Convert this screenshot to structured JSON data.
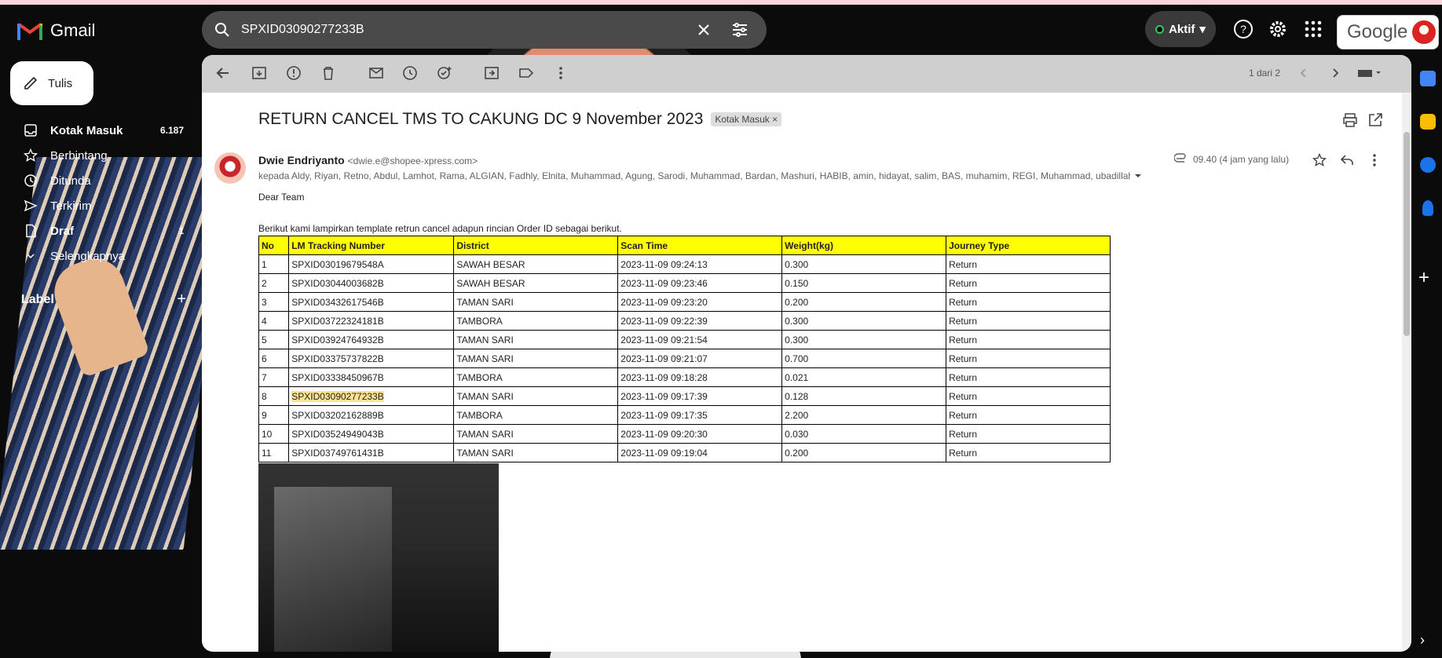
{
  "app": {
    "name": "Gmail",
    "brand_google": "Google"
  },
  "search": {
    "value": "SPXID03090277233B"
  },
  "status": {
    "label": "Aktif",
    "color": "#34c759"
  },
  "compose": {
    "label": "Tulis"
  },
  "nav": {
    "items": [
      {
        "label": "Kotak Masuk",
        "count": "6.187",
        "icon": "inbox-icon"
      },
      {
        "label": "Berbintang",
        "count": "",
        "icon": "star-icon"
      },
      {
        "label": "Ditunda",
        "count": "",
        "icon": "clock-icon"
      },
      {
        "label": "Terkirim",
        "count": "",
        "icon": "send-icon"
      },
      {
        "label": "Draf",
        "count": "1",
        "icon": "draft-icon"
      },
      {
        "label": "Selengkapnya",
        "count": "",
        "icon": "chevron-down-icon"
      }
    ]
  },
  "labels": {
    "title": "Label"
  },
  "pager": {
    "text": "1 dari 2"
  },
  "email": {
    "subject": "RETURN CANCEL TMS TO CAKUNG DC 9 November 2023",
    "tag": "Kotak Masuk",
    "sender_name": "Dwie Endriyanto",
    "sender_email": "<dwie.e@shopee-xpress.com>",
    "recipients": "kepada Aldy, Riyan, Retno, Abdul, Lamhot, Rama, ALGIAN, Fadhly, Elnita, Muhammad, Agung, Sarodi, Muhammad, Bardan, Mashuri, HABIB, amin, hidayat, salim, BAS, muhamim, REGI, Muhammad, ubadillah, harvala, alfriza, bas_riski.agus, Ravi, G",
    "time": "09.40 (4 jam yang lalu)",
    "greeting": "Dear Team",
    "intro": "Berikut kami lampirkan template retrun cancel adapun rincian Order ID sebagai berikut.",
    "table": {
      "headers": [
        "No",
        "LM Tracking Number",
        "District",
        "Scan Time",
        "Weight(kg)",
        "Journey Type"
      ],
      "rows": [
        [
          "1",
          "SPXID03019679548A",
          "SAWAH BESAR",
          "2023-11-09 09:24:13",
          "0.300",
          "Return"
        ],
        [
          "2",
          "SPXID03044003682B",
          "SAWAH BESAR",
          "2023-11-09 09:23:46",
          "0.150",
          "Return"
        ],
        [
          "3",
          "SPXID03432617546B",
          "TAMAN SARI",
          "2023-11-09 09:23:20",
          "0.200",
          "Return"
        ],
        [
          "4",
          "SPXID03722324181B",
          "TAMBORA",
          "2023-11-09 09:22:39",
          "0.300",
          "Return"
        ],
        [
          "5",
          "SPXID03924764932B",
          "TAMAN SARI",
          "2023-11-09 09:21:54",
          "0.300",
          "Return"
        ],
        [
          "6",
          "SPXID03375737822B",
          "TAMAN SARI",
          "2023-11-09 09:21:07",
          "0.700",
          "Return"
        ],
        [
          "7",
          "SPXID03338450967B",
          "TAMBORA",
          "2023-11-09 09:18:28",
          "0.021",
          "Return"
        ],
        [
          "8",
          "SPXID03090277233B",
          "TAMAN SARI",
          "2023-11-09 09:17:39",
          "0.128",
          "Return"
        ],
        [
          "9",
          "SPXID03202162889B",
          "TAMBORA",
          "2023-11-09 09:17:35",
          "2.200",
          "Return"
        ],
        [
          "10",
          "SPXID03524949043B",
          "TAMAN SARI",
          "2023-11-09 09:20:30",
          "0.030",
          "Return"
        ],
        [
          "11",
          "SPXID03749761431B",
          "TAMAN SARI",
          "2023-11-09 09:19:04",
          "0.200",
          "Return"
        ]
      ]
    }
  }
}
